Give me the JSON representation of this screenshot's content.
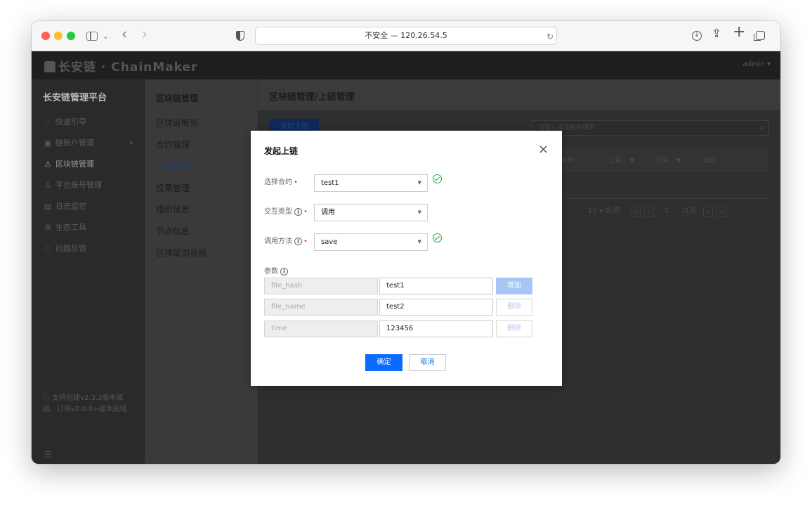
{
  "browser": {
    "address": "不安全 — 120.26.54.5"
  },
  "header": {
    "logo": "长安链 · ChainMaker",
    "user": "admin ▾"
  },
  "left_nav": {
    "title": "长安链管理平台",
    "items": [
      {
        "icon": "lightbulb-icon",
        "glyph": "♢",
        "label": "快速引导"
      },
      {
        "icon": "account-icon",
        "glyph": "▣",
        "label": "链账户管理"
      },
      {
        "icon": "blockchain-icon",
        "glyph": "⚠",
        "label": "区块链管理"
      },
      {
        "icon": "user-icon",
        "glyph": "♙",
        "label": "平台账号管理"
      },
      {
        "icon": "monitor-icon",
        "glyph": "▤",
        "label": "日志监控"
      },
      {
        "icon": "tools-icon",
        "glyph": "⚙",
        "label": "生态工具"
      },
      {
        "icon": "feedback-icon",
        "glyph": "◌",
        "label": "问题反馈"
      }
    ],
    "version_note": "ⓘ 支持创建v2.3.2版本底链、订阅v2.0.0+版本底链",
    "collapse_glyph": "☰"
  },
  "sub_nav": {
    "title": "区块链管理",
    "items": [
      "区块链概览",
      "合约管理",
      "上链管理",
      "投票管理",
      "组织信息",
      "节点信息",
      "区块链浏览器"
    ]
  },
  "main": {
    "breadcrumb": "区块链管理/上链管理",
    "launch_button": "发起上链",
    "search_placeholder": "请输入查询条件搜索",
    "table_headers": [
      "合约",
      "上链... ▼",
      "交易... ▼",
      "操作"
    ],
    "pager": {
      "page_size": "10 ▾ 条/页",
      "current_page": "1",
      "total_pages": "/1页"
    }
  },
  "modal": {
    "title": "发起上链",
    "close": "×",
    "fields": {
      "contract_label": "选择合约",
      "contract_value": "test1",
      "interaction_label": "交互类型",
      "interaction_value": "调用",
      "method_label": "调用方法",
      "method_value": "save"
    },
    "params_label": "参数",
    "params": [
      {
        "key": "file_hash",
        "value": "test1",
        "action": "增加"
      },
      {
        "key": "file_name",
        "value": "test2",
        "action": "删除"
      },
      {
        "key": "time",
        "value": "123456",
        "action": "删除"
      }
    ],
    "confirm": "确定",
    "cancel": "取消"
  }
}
